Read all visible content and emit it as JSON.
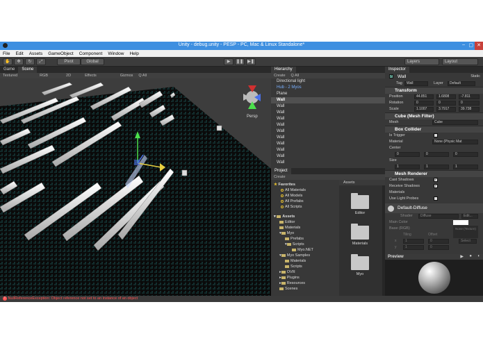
{
  "window": {
    "title": "Unity - debug.unity - PESP - PC, Mac & Linux Standalone*"
  },
  "menu": [
    "File",
    "Edit",
    "Assets",
    "GameObject",
    "Component",
    "Window",
    "Help"
  ],
  "toolbar": {
    "pivot": "Pivot",
    "global": "Global",
    "layers": "Layers",
    "layout": "Layout"
  },
  "scene": {
    "tabs": [
      "Game",
      "Scene"
    ],
    "bar": {
      "render_mode": "Textured",
      "color_mode": "RGB",
      "mode_2d": "2D",
      "effects": "Effects",
      "gizmos": "Gizmos",
      "search": "Q All"
    },
    "persp": "Persp"
  },
  "hierarchy": {
    "tab": "Hierarchy",
    "create": "Create",
    "search": "Q All",
    "items": [
      "Directional light",
      "Hub - 2 Myos",
      "Plane",
      "Wall",
      "Wall",
      "Wall",
      "Wall",
      "Wall",
      "Wall",
      "Wall",
      "Wall",
      "Wall",
      "Wall",
      "Wall",
      "Wall"
    ]
  },
  "project": {
    "tab": "Project",
    "create": "Create",
    "favorites": {
      "label": "Favorites",
      "items": [
        "All Materials",
        "All Models",
        "All Prefabs",
        "All Scripts"
      ]
    },
    "tree": {
      "label": "Assets",
      "items": [
        {
          "label": "Editor",
          "indent": 1
        },
        {
          "label": "Materials",
          "indent": 1
        },
        {
          "label": "Myo",
          "indent": 1
        },
        {
          "label": "Prefabs",
          "indent": 2
        },
        {
          "label": "Scripts",
          "indent": 2
        },
        {
          "label": "Myo.NET",
          "indent": 3
        },
        {
          "label": "Myo Samples",
          "indent": 1
        },
        {
          "label": "Materials",
          "indent": 2
        },
        {
          "label": "Scripts",
          "indent": 2
        },
        {
          "label": "OVR",
          "indent": 1
        },
        {
          "label": "Plugins",
          "indent": 1
        },
        {
          "label": "Resources",
          "indent": 1
        },
        {
          "label": "Scenes",
          "indent": 1
        }
      ]
    },
    "assets_header": "Assets",
    "folders": [
      "Editor",
      "Materials",
      "Myo"
    ]
  },
  "inspector": {
    "tab": "Inspector",
    "object_name": "Wall",
    "static": "Static",
    "tag_label": "Tag",
    "tag": "Wall",
    "layer_label": "Layer",
    "layer": "Default",
    "transform": {
      "title": "Transform",
      "position": {
        "label": "Position",
        "x": "44.851",
        "y": "1.6808",
        "z": "-7.811"
      },
      "rotation": {
        "label": "Rotation",
        "x": "0",
        "y": "0",
        "z": "0"
      },
      "scale": {
        "label": "Scale",
        "x": "1.1007",
        "y": "3.7917",
        "z": "39.738"
      }
    },
    "mesh_filter": {
      "title": "Cube (Mesh Filter)",
      "mesh_label": "Mesh",
      "mesh": "Cube"
    },
    "box_collider": {
      "title": "Box Collider",
      "is_trigger": "Is Trigger",
      "material_label": "Material",
      "material": "None (Physic Mat",
      "center_label": "Center",
      "center": {
        "x": "0",
        "y": "0",
        "z": "0"
      },
      "size_label": "Size",
      "size": {
        "x": "1",
        "y": "1",
        "z": "1"
      }
    },
    "mesh_renderer": {
      "title": "Mesh Renderer",
      "cast_shadows": "Cast Shadows",
      "receive_shadows": "Receive Shadows",
      "materials": "Materials",
      "light_probes": "Use Light Probes"
    },
    "material": {
      "name": "Default-Diffuse",
      "shader_label": "Shader",
      "shader": "Diffuse",
      "edit": "Edit...",
      "main_color": "Main Color",
      "base": "Base (RGB)",
      "tiling": "Tiling",
      "offset": "Offset",
      "none_texture": "None (Texture)",
      "select": "Select",
      "tx": "1",
      "ty": "1",
      "ox": "0",
      "oy": "0"
    },
    "preview": "Preview"
  },
  "status": {
    "message": "NullReferenceException: Object reference not set to an instance of an object"
  },
  "colors": {
    "accent": "#3e8fe0",
    "error": "#ff5050"
  }
}
